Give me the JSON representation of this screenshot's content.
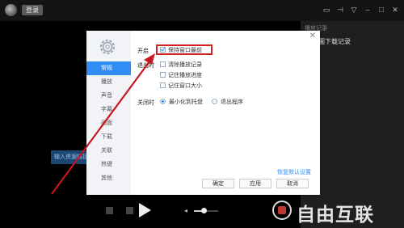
{
  "topbar": {
    "login_label": "登录",
    "icons": [
      "folder-icon",
      "pin-icon",
      "menu-icon",
      "minimize-icon",
      "restore-icon",
      "close-icon"
    ]
  },
  "right_panel": {
    "title": "播放记录",
    "record_label": "圖下载记录"
  },
  "main": {
    "input_text": "输入资源链接"
  },
  "dialog": {
    "nav": [
      "常规",
      "播放",
      "声音",
      "字幕",
      "画面",
      "下载",
      "关联",
      "热键",
      "其他"
    ],
    "active_nav": "常规",
    "startup": {
      "label": "开启",
      "keep_on_top": "保持窗口最前",
      "keep_on_top_checked": true
    },
    "exit_section": {
      "label": "退出时",
      "clear_history": "清除播放记录",
      "remember_progress": "记住播放进度",
      "remember_size": "记住窗口大小"
    },
    "close_section": {
      "label": "关闭时",
      "minimize_tray": "最小化到托盘",
      "exit_program": "退出程序",
      "selected": "minimize_tray"
    },
    "reset_link": "恢复默认设置",
    "buttons": {
      "ok": "确定",
      "apply": "应用",
      "cancel": "取消"
    }
  },
  "controls": {
    "volume_level": 0.4
  },
  "watermark": {
    "text": "自由互联"
  },
  "colors": {
    "accent": "#2f8df4",
    "highlight": "#d0201f",
    "arrow": "#c8151f"
  }
}
